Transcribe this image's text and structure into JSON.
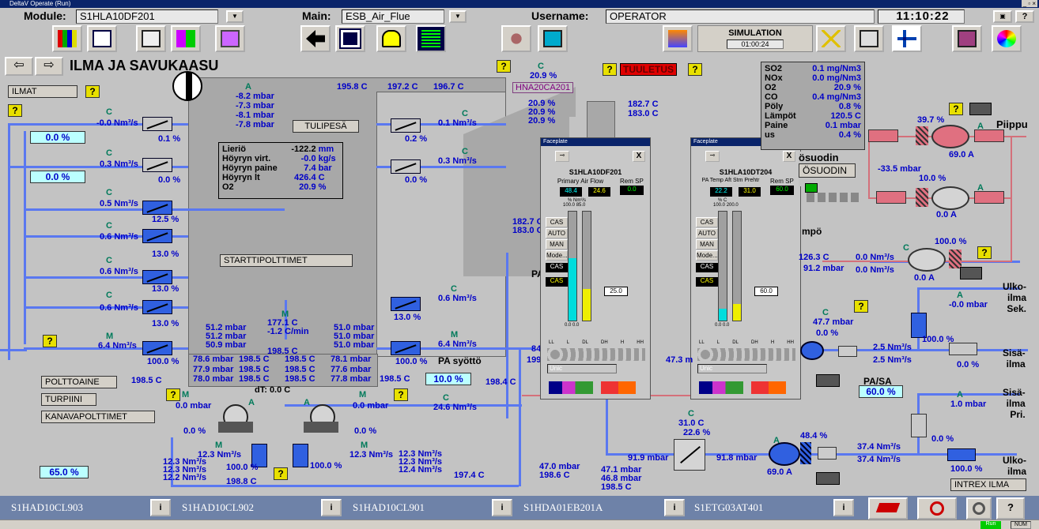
{
  "window_title": "DeltaV Operate (Run)",
  "header": {
    "module_label": "Module:",
    "module_value": "S1HLA10DF201",
    "main_label": "Main:",
    "main_value": "ESB_Air_Flue",
    "username_label": "Username:",
    "username_value": "OPERATOR",
    "time": "11:10:22",
    "simulation_label": "SIMULATION",
    "simulation_time": "01:00:24",
    "help": "?"
  },
  "screen_title": "ILMA JA SAVUKAASU",
  "left_labels": {
    "ilmat": "ILMAT",
    "polttoaine": "POLTTOAINE",
    "turpiini": "TURPIINI",
    "kanavapolttimet": "KANAVAPOLTTIMET"
  },
  "q": "?",
  "c": "C",
  "m": "M",
  "a": "A",
  "left_dampers": [
    {
      "flow": "-0.0 Nm³/s",
      "pos": "0.1 %",
      "mode": "C"
    },
    {
      "flow": "0.3 Nm³/s",
      "pos": "0.0 %",
      "mode": "C"
    },
    {
      "flow": "0.5 Nm³/s",
      "pos": "12.5 %",
      "mode": "C"
    },
    {
      "flow": "0.6 Nm³/s",
      "pos": "13.0 %",
      "mode": "C"
    },
    {
      "flow": "0.6 Nm³/s",
      "pos": "13.0 %",
      "mode": "C"
    },
    {
      "flow": "0.6 Nm³/s",
      "pos": "13.0 %",
      "mode": "C"
    },
    {
      "flow": "6.4 Nm³/s",
      "pos": "100.0 %",
      "mode": "M"
    }
  ],
  "left_pct": [
    "0.0 %",
    "0.0 %",
    "65.0 %"
  ],
  "furnace": {
    "pressures": [
      "-8.2 mbar",
      "-7.3 mbar",
      "-8.1 mbar",
      "-7.8 mbar"
    ],
    "tulipesa": "TULIPESÄ",
    "top_temps": [
      "195.8 C",
      "197.2 C",
      "196.7 C"
    ],
    "info_rows": [
      {
        "label": "Lieriö",
        "value": "-122.2",
        "unit": "mm"
      },
      {
        "label": "Höyryn virt.",
        "value": "-0.0",
        "unit": "kg/s"
      },
      {
        "label": "Höyryn paine",
        "value": "7.4",
        "unit": "bar"
      },
      {
        "label": "Höyryn lt",
        "value": "426.4",
        "unit": "C"
      },
      {
        "label": "O2",
        "value": "20.9",
        "unit": "%"
      }
    ],
    "starttipolttimet": "STARTTIPOLTTIMET",
    "right_dampers": [
      {
        "flow": "0.1 Nm³/s",
        "pos": "0.2 %"
      },
      {
        "flow": "0.3 Nm³/s",
        "pos": "0.0 %"
      },
      {
        "flow": "0.6 Nm³/s",
        "pos": "13.0 %"
      },
      {
        "flow": "6.4 Nm³/s",
        "pos": "100.0 %"
      }
    ],
    "bottom_left": [
      "51.2 mbar",
      "51.2 mbar",
      "50.9 mbar"
    ],
    "bottom_mid": [
      "177.1 C",
      "-1.2 C/min",
      "198.5 C"
    ],
    "bottom_right": [
      "51.0 mbar",
      "51.0 mbar",
      "51.0 mbar"
    ],
    "grid": [
      [
        "78.6 mbar",
        "198.5 C",
        "198.5 C",
        "78.1 mbar"
      ],
      [
        "77.9 mbar",
        "198.5 C",
        "198.5 C",
        "77.6 mbar"
      ],
      [
        "78.0 mbar",
        "198.5 C",
        "198.5 C",
        "77.8 mbar"
      ]
    ],
    "dt": "dT: 0.0 C",
    "temp_left": "198.5 C",
    "temp_right": "198.5 C",
    "pa_syotto": "PA syöttö",
    "pa_pct": "10.0 %"
  },
  "o2_block": [
    "20.9 %",
    "HNA20CA201",
    "20.9 %",
    "20.9 %",
    "20.9 %"
  ],
  "tuuletus": "TUULETUS",
  "stack_temps": [
    "182.7 C",
    "183.0 C",
    "182.7 C",
    "183.0 C"
  ],
  "fans_bottom": {
    "left_mbar": "0.0 mbar",
    "left_pct": "0.0 %",
    "right_mbar": "0.0 mbar",
    "right_pct": "0.0 %",
    "flow1": "12.3 Nm³/s",
    "flow2": "12.3 Nm³/s",
    "lhs_flows": [
      "12.3 Nm³/s",
      "12.3 Nm³/s",
      "12.2 Nm³/s"
    ],
    "rhs_flows": [
      "12.3 Nm³/s",
      "12.3 Nm³/s",
      "12.4 Nm³/s"
    ],
    "pct1": "100.0 %",
    "pct2": "100.0 %",
    "temp_left": "198.8 C",
    "temp_right": "197.4 C",
    "mid_flow": "24.6 Nm³/s",
    "temp_198": "198.4 C",
    "mbar47": "47.0 mbar",
    "temp198_6": "198.6 C",
    "mbar47b": [
      "47.1 mbar",
      "46.8 mbar",
      "198.5 C"
    ]
  },
  "emissions": [
    {
      "label": "SO2",
      "value": "0.1 mg/Nm3"
    },
    {
      "label": "NOx",
      "value": "0.0 mg/Nm3"
    },
    {
      "label": "O2",
      "value": "20.9 %"
    },
    {
      "label": "CO",
      "value": "0.4 mg/Nm3"
    },
    {
      "label": "Pöly",
      "value": "0.8 %"
    },
    {
      "label": "Lämpöt",
      "value": "120.5 C"
    },
    {
      "label": "Paine",
      "value": "0.1 mbar"
    },
    {
      "label": "us",
      "value": "0.4 %"
    }
  ],
  "right_side": {
    "piippu": "Piippu",
    "fan_pct": "39.7 %",
    "fan_a": "69.0 A",
    "suodin1": "ösuodin",
    "suodin2": "ÖSUODIN",
    "mbar": "-33.5 mbar",
    "fan2_pct": "10.0 %",
    "fan2_a": "0.0 A",
    "lampo": "mpö",
    "temp126": "126.3 C",
    "mbar91": "91.2 mbar",
    "flow_a": "0.0 Nm³/s",
    "flow_b": "0.0 Nm³/s",
    "pct100": "100.0 %",
    "a00": "0.0 A",
    "ulko_sek": [
      "Ulko-",
      "ilma",
      "Sek."
    ],
    "minus_mbar": "-0.0 mbar",
    "mbar47_7": "47.7 mbar",
    "pct0": "0.0 %",
    "pct100b": "100.0 %",
    "flow25a": "2.5 Nm³/s",
    "flow25b": "2.5 Nm³/s",
    "pct0b": "0.0 %",
    "sisa1": [
      "Sisä-",
      "ilma"
    ],
    "pasa": "PA/SA",
    "pasa_val": "60.0 %",
    "sisa_pri": [
      "Sisä-",
      "ilma",
      "Pri."
    ],
    "mbar1": "1.0 mbar",
    "pct0c": "0.0 %",
    "temp31": "31.0 C",
    "pct22": "22.6 %",
    "mbar91_9": "91.9 mbar",
    "mbar91_8": "91.8 mbar",
    "fan3_pct": "48.4 %",
    "fan3_a": "69.0 A",
    "flow37a": "37.4 Nm³/s",
    "flow37b": "37.4 Nm³/s",
    "pct100c": "100.0 %",
    "ulko2": [
      "Ulko-",
      "ilma"
    ],
    "intrex": "INTREX ILMA",
    "temp_pa": "PA",
    "val84": "84",
    "val199": "199",
    "val47_3": "47.3 m"
  },
  "faceplate1": {
    "title": "Faceplate",
    "tag": "S1HLA10DF201",
    "desc": "Primary Air Flow",
    "rem_sp": "Rem SP",
    "pv": "48.4",
    "sp": "24.6",
    "out": "0.0",
    "scale_left": "100.0",
    "scale_right": "85.0",
    "units_left": "%",
    "units_right": "Nm³/s",
    "btn_cas": "CAS",
    "btn_auto": "AUTO",
    "btn_man": "MAN",
    "btn_mode": "Mode...",
    "mode1": "CAS",
    "mode2": "CAS",
    "value_box": "25.0",
    "zero_l": "0.0",
    "zero_r": "0.0",
    "alarm_labels": [
      "LL",
      "L",
      "DL",
      "DH",
      "H",
      "HH"
    ],
    "unit_box": "Unic",
    "pv_fill": 0.57,
    "sp_fill": 0.29
  },
  "faceplate2": {
    "title": "Faceplate",
    "tag": "S1HLA10DT204",
    "desc": "PA Temp Aft Stm Prehtr",
    "rem_sp": "Rem SP",
    "pv": "22.2",
    "sp": "31.0",
    "out": "60.0",
    "scale_left": "100.0",
    "scale_right": "200.0",
    "units_left": "%",
    "units_right": "C",
    "btn_cas": "CAS",
    "btn_auto": "AUTO",
    "btn_man": "MAN",
    "btn_mode": "Mode...",
    "mode1": "CAS",
    "mode2": "CAS",
    "value_box": "60.0",
    "zero_l": "0.0",
    "zero_r": "0.0",
    "alarm_labels": [
      "LL",
      "L",
      "DL",
      "DH",
      "H",
      "HH"
    ],
    "unit_box": "Unic",
    "pv_fill": 0.11,
    "sp_fill": 0.15
  },
  "statusbar": {
    "items": [
      "S1HAD10CL903",
      "S1HAD10CL902",
      "S1HAD10CL901",
      "S1HDA01EB201A",
      "S1ETG03AT401"
    ],
    "i_labels": [
      "i",
      "i",
      "i",
      "i",
      "i"
    ],
    "help": "?"
  },
  "bottom_right": {
    "run": "Run",
    "num": "NUM"
  },
  "colors": {
    "bg": "#c3c3c3",
    "flow_blue": "#5a78f0",
    "flue_red": "#d4707a",
    "teal": "#007a5a",
    "value_blue": "#0000c8"
  }
}
